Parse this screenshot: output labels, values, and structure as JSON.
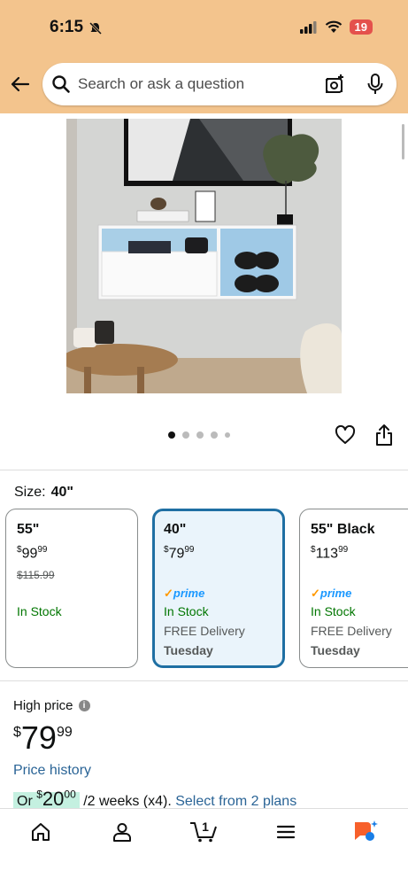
{
  "status_bar": {
    "time": "6:15",
    "battery": "19"
  },
  "search": {
    "placeholder": "Search or ask a question"
  },
  "carousel": {
    "dot_count": 5,
    "active_index": 0
  },
  "size": {
    "label": "Size:",
    "value": "40\""
  },
  "options": [
    {
      "name": "55\"",
      "price_symbol": "$",
      "price_whole": "99",
      "price_fraction": "99",
      "list_price": "$115.99",
      "stock": "In Stock",
      "selected": false
    },
    {
      "name": "40\"",
      "price_symbol": "$",
      "price_whole": "79",
      "price_fraction": "99",
      "prime": "prime",
      "stock": "In Stock",
      "delivery": "FREE Delivery",
      "delivery_day": "Tuesday",
      "selected": true
    },
    {
      "name": "55\" Black",
      "price_symbol": "$",
      "price_whole": "113",
      "price_fraction": "99",
      "prime": "prime",
      "stock": "In Stock",
      "delivery": "FREE Delivery",
      "delivery_day": "Tuesday",
      "selected": false
    }
  ],
  "pricing": {
    "label": "High price",
    "info_glyph": "i",
    "symbol": "$",
    "whole": "79",
    "fraction": "99",
    "history_link": "Price history",
    "plan_prefix": "Or ",
    "plan_symbol": "$",
    "plan_whole": "20",
    "plan_fraction": "00",
    "plan_suffix": " /2 weeks (x4). ",
    "plan_link": "Select from 2 plans"
  },
  "nav": {
    "cart_count": "1"
  },
  "colors": {
    "header_bg": "#f3c48d",
    "selected_border": "#1f6fa3",
    "stock_green": "#007600",
    "link_blue": "#2a6496",
    "prime_blue": "#1a98ff",
    "battery_red": "#e4514c"
  }
}
